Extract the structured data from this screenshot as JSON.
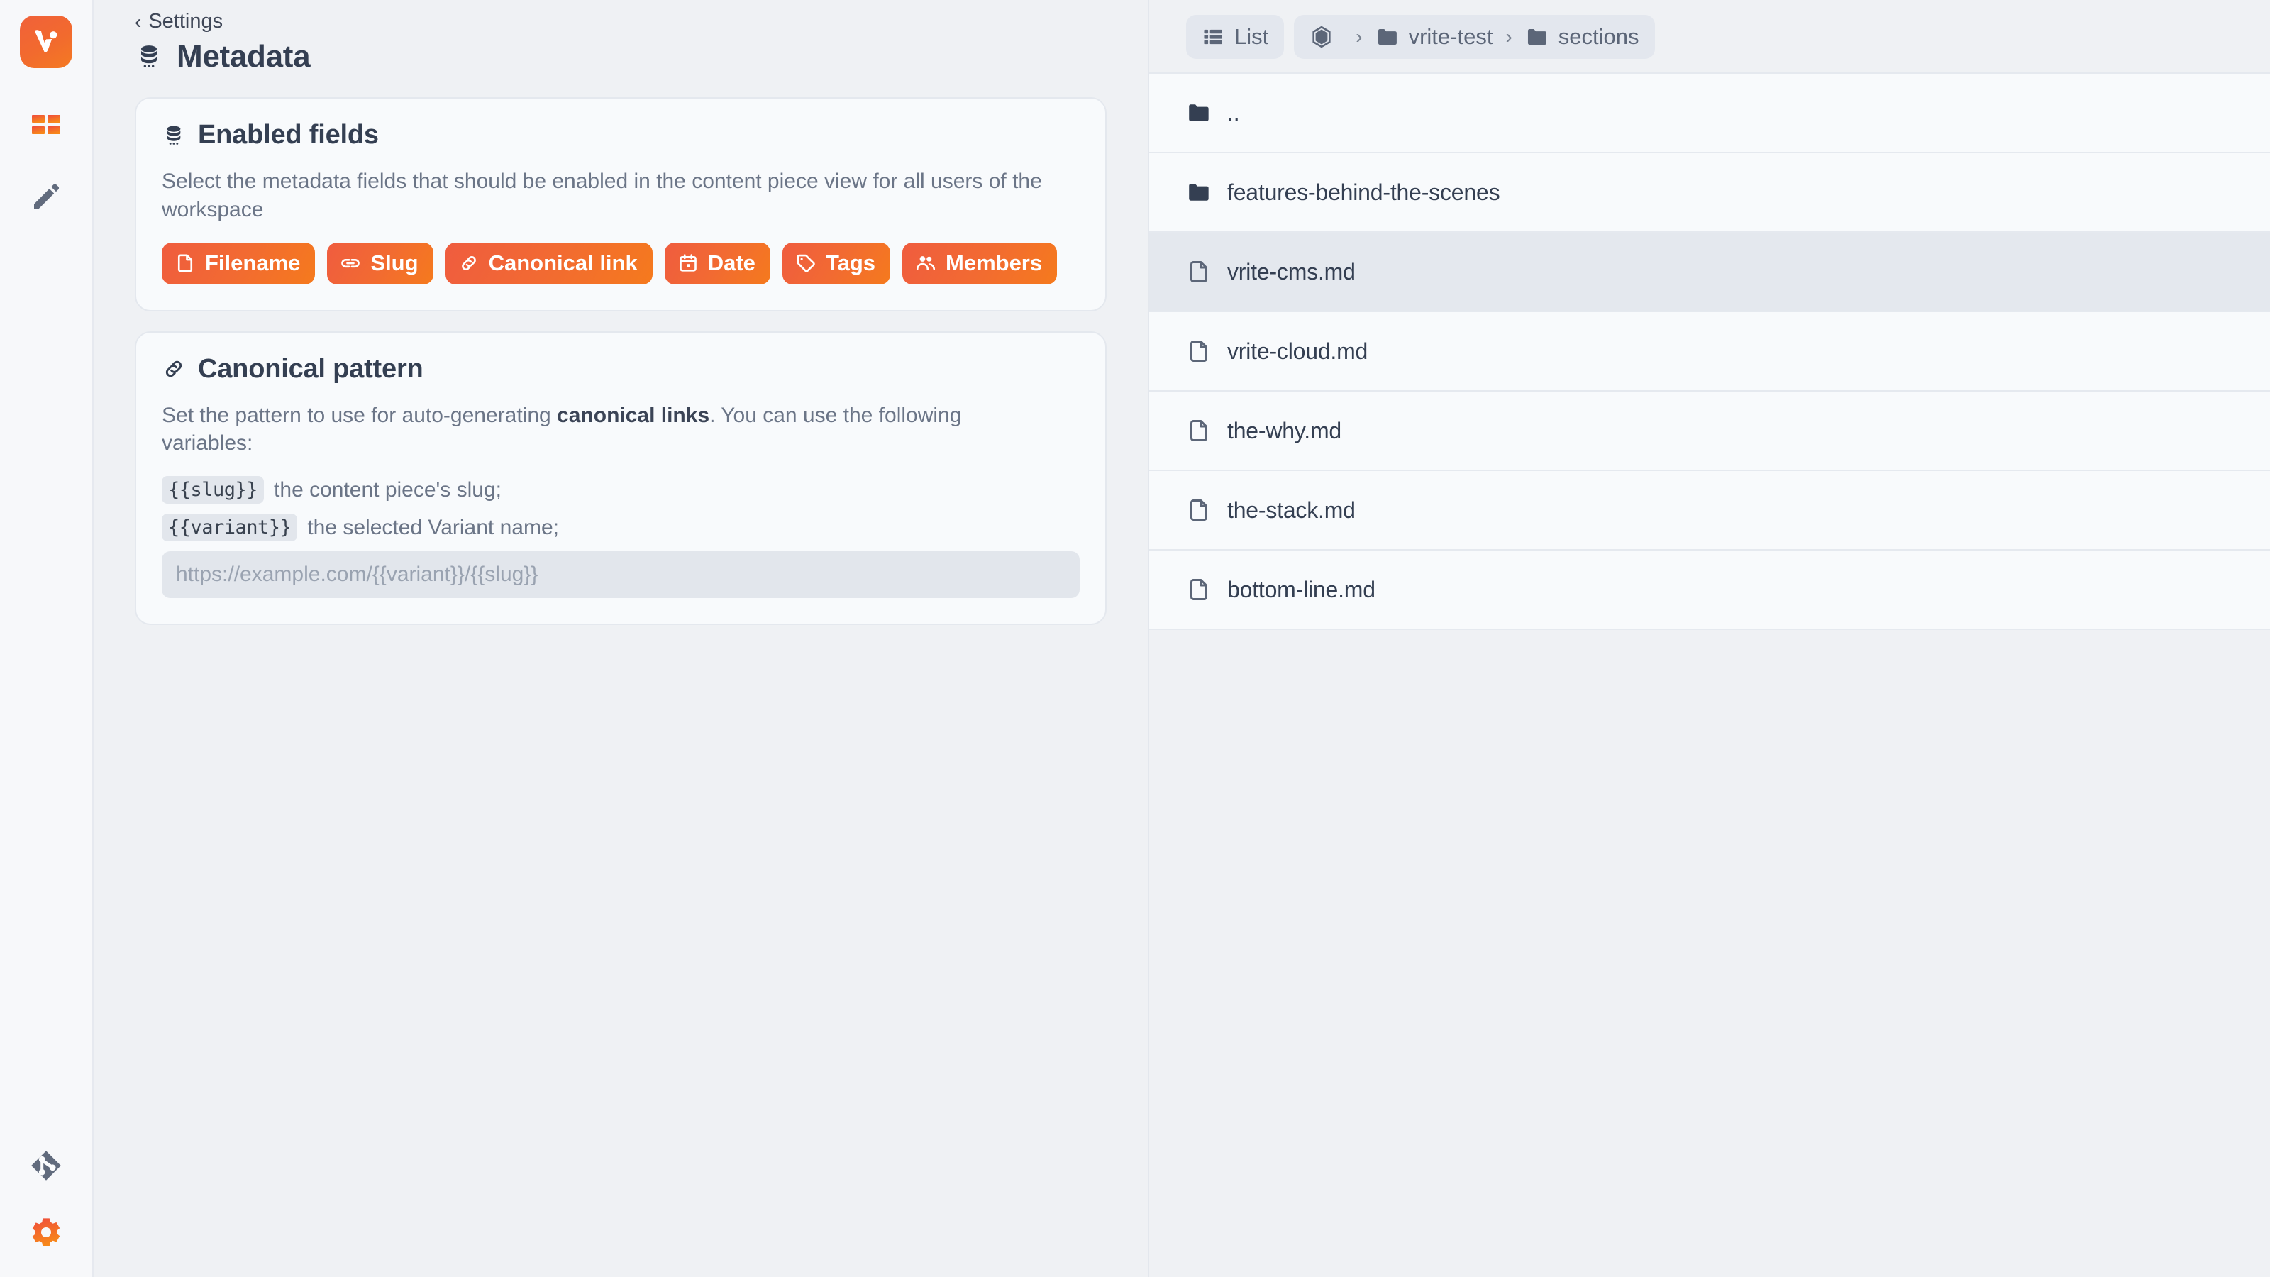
{
  "sidebar": {
    "logo": {
      "name": "vrite-logo",
      "alt": "Vrite"
    },
    "items": [
      {
        "icon": "dashboard-grid-icon",
        "label": "Dashboard"
      },
      {
        "icon": "pencil-icon",
        "label": "Editor"
      }
    ],
    "bottom_items": [
      {
        "icon": "git-branch-icon",
        "label": "Git"
      },
      {
        "icon": "gear-icon",
        "label": "Settings"
      }
    ]
  },
  "settings": {
    "back_label": "Settings",
    "back_icon": "chevron-left-icon",
    "title": "Metadata",
    "title_icon": "database-stack-icon",
    "enabled_fields": {
      "title": "Enabled fields",
      "icon": "database-stack-icon",
      "description": "Select the metadata fields that should be enabled in the content piece view for all users of the workspace",
      "chips": [
        {
          "label": "Filename",
          "icon": "file-icon"
        },
        {
          "label": "Slug",
          "icon": "link-chain-icon"
        },
        {
          "label": "Canonical link",
          "icon": "link-icon"
        },
        {
          "label": "Date",
          "icon": "calendar-icon"
        },
        {
          "label": "Tags",
          "icon": "tag-icon"
        },
        {
          "label": "Members",
          "icon": "members-icon"
        }
      ]
    },
    "canonical_pattern": {
      "title": "Canonical pattern",
      "icon": "link-icon",
      "description_part1": "Set the pattern to use for auto-generating ",
      "description_bold": "canonical links",
      "description_part2": ". You can use the following variables:",
      "variables": [
        {
          "code": "{{slug}}",
          "text": "the content piece's slug;"
        },
        {
          "code": "{{variant}}",
          "text": "the selected Variant name;"
        }
      ],
      "input_placeholder": "https://example.com/{{variant}}/{{slug}}",
      "input_value": ""
    }
  },
  "explorer": {
    "view_button": {
      "label": "List",
      "icon": "list-icon"
    },
    "breadcrumb": [
      {
        "label": "",
        "icon": "hexagon-icon"
      },
      {
        "label": "vrite-test",
        "icon": "folder-icon"
      },
      {
        "label": "sections",
        "icon": "folder-icon"
      }
    ],
    "separator": "›",
    "rows": [
      {
        "label": "..",
        "icon": "folder-icon",
        "type": "folder",
        "selected": false
      },
      {
        "label": "features-behind-the-scenes",
        "icon": "folder-icon",
        "type": "folder",
        "selected": false
      },
      {
        "label": "vrite-cms.md",
        "icon": "file-icon",
        "type": "file",
        "selected": true
      },
      {
        "label": "vrite-cloud.md",
        "icon": "file-icon",
        "type": "file",
        "selected": false
      },
      {
        "label": "the-why.md",
        "icon": "file-icon",
        "type": "file",
        "selected": false
      },
      {
        "label": "the-stack.md",
        "icon": "file-icon",
        "type": "file",
        "selected": false
      },
      {
        "label": "bottom-line.md",
        "icon": "file-icon",
        "type": "file",
        "selected": false
      }
    ]
  },
  "colors": {
    "accent_start": "#ef5c3f",
    "accent_end": "#f57a1d",
    "text_dark": "#343f52",
    "text_muted": "#6b7587",
    "panel_bg": "#eff1f4",
    "card_bg": "#f8fafc",
    "selected_row": "#e4e8ee"
  }
}
